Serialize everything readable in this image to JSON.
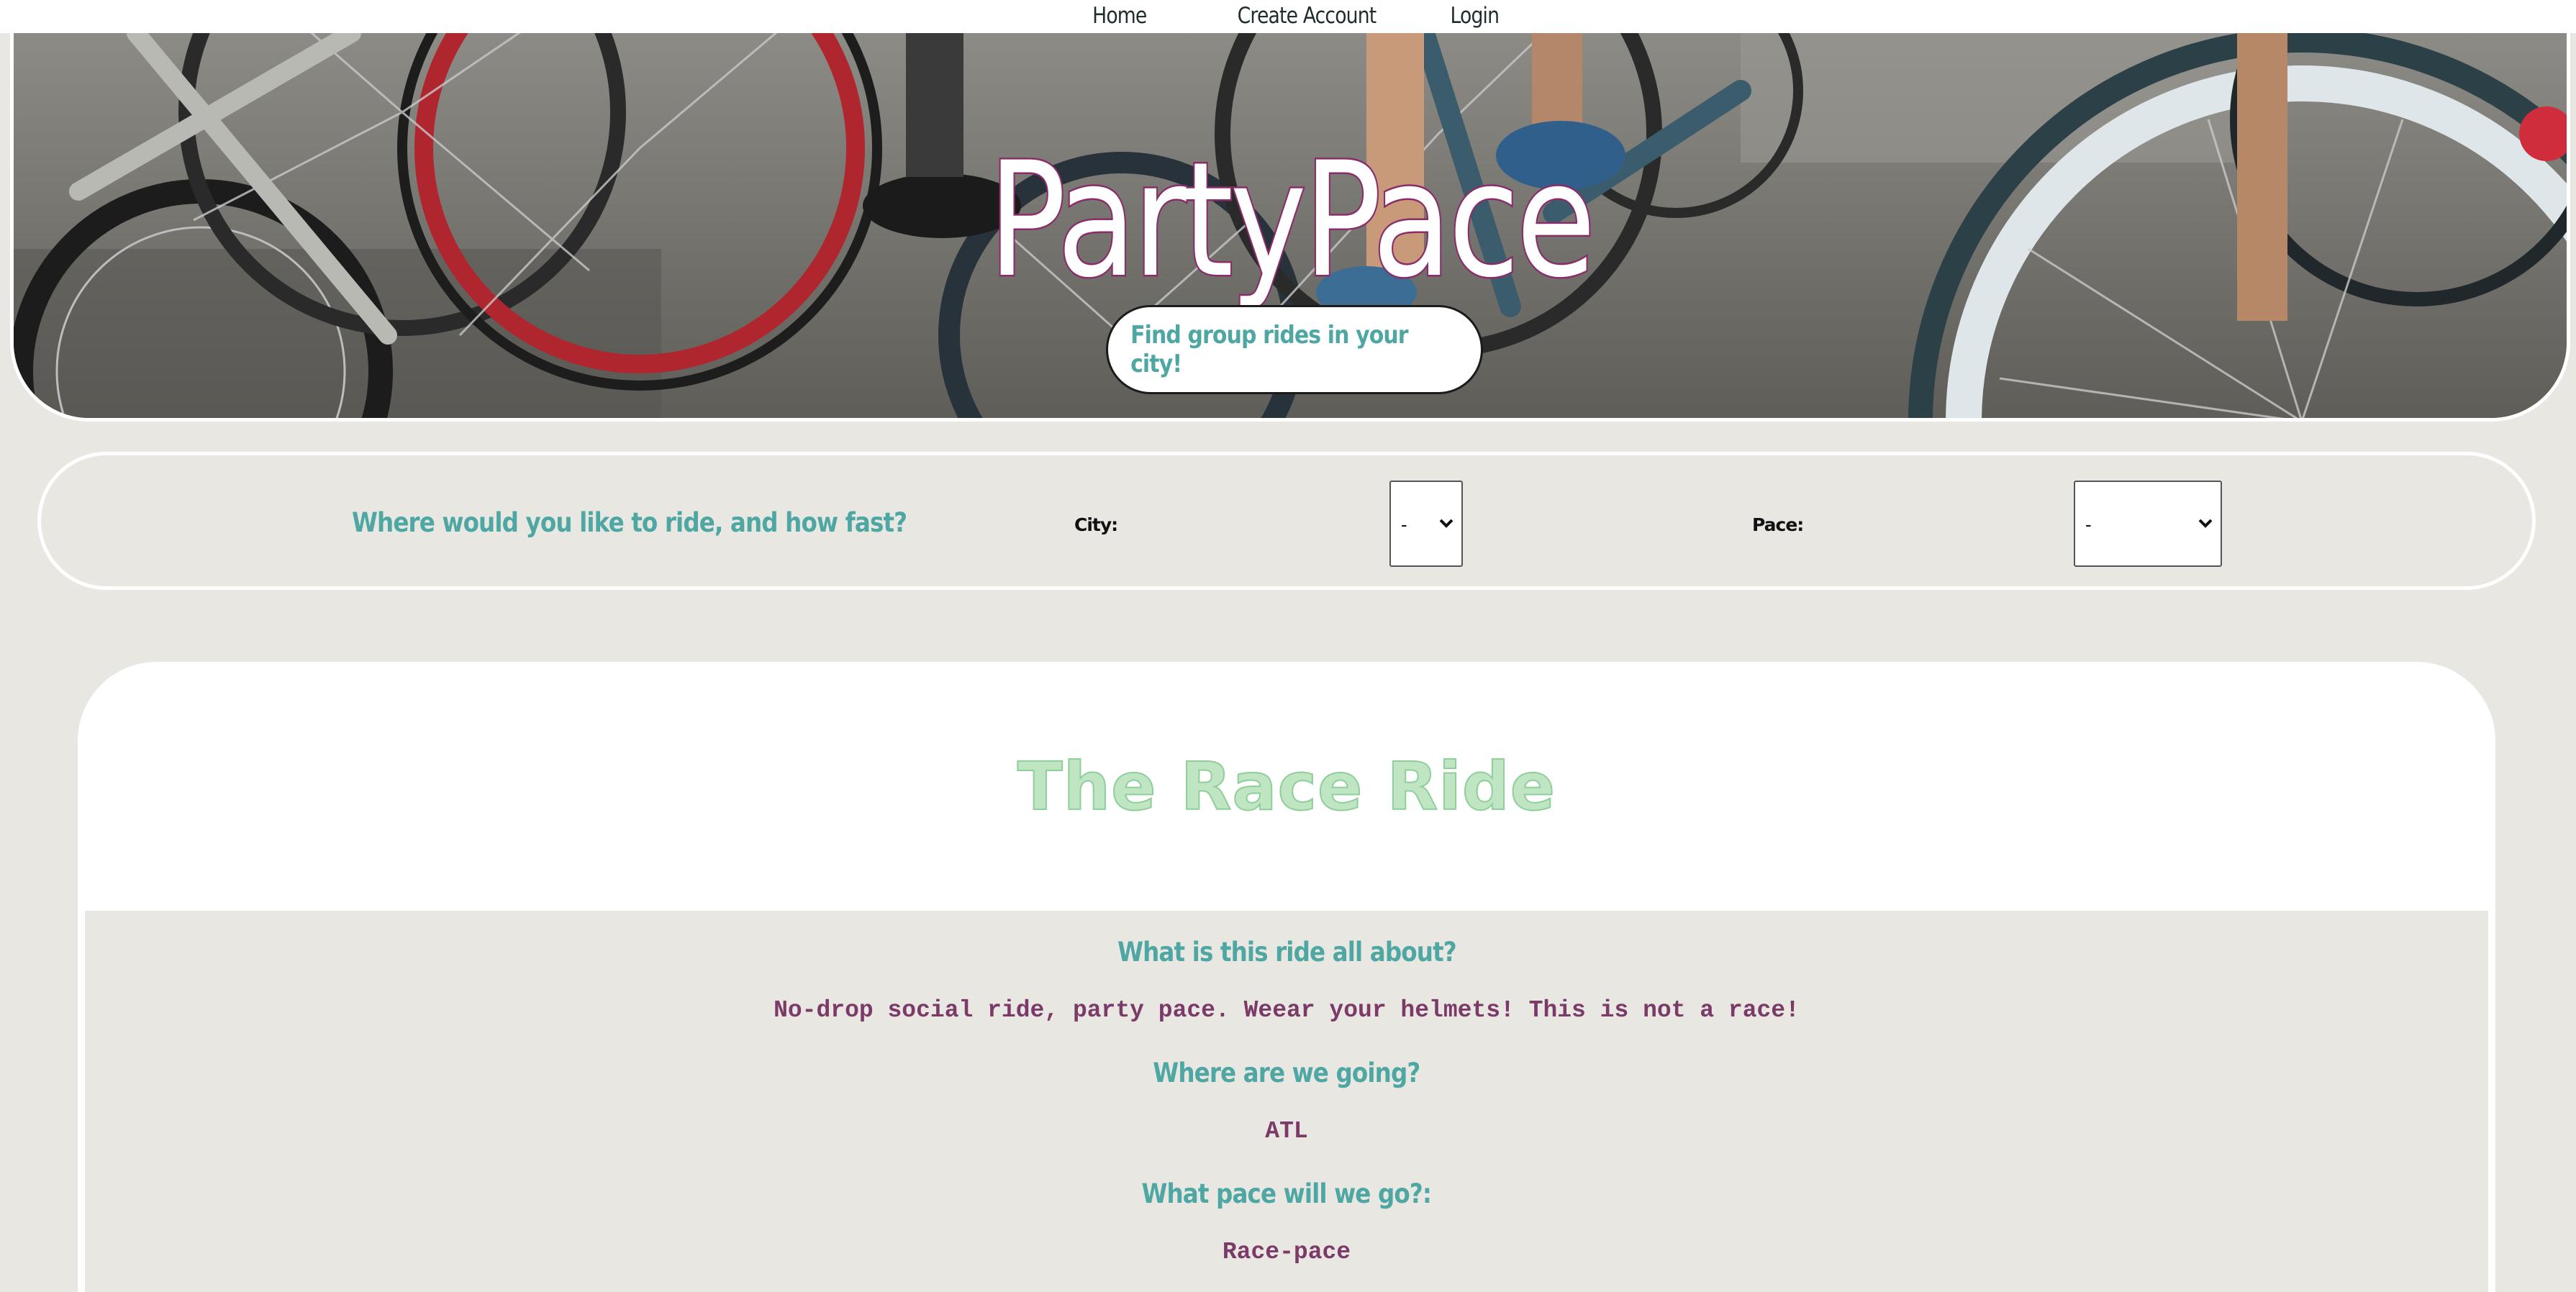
{
  "nav": {
    "home": "Home",
    "create_account": "Create Account",
    "login": "Login"
  },
  "hero": {
    "title": "PartyPace",
    "cta": "Find group rides in your city!",
    "background": "photo of bicycles and riders' legs on pavement"
  },
  "filter": {
    "question": "Where would you like to ride, and how fast?",
    "city_label": "City:",
    "city_value": "-",
    "pace_label": "Pace:",
    "pace_value": "-"
  },
  "ride": {
    "title": "The Race Ride",
    "about_q": "What is this ride all about?",
    "about_a": "No-drop social ride, party pace. Weear your helmets! This is not a race!",
    "where_q": "Where are we going?",
    "where_a": "ATL",
    "pace_q": "What pace will we go?:",
    "pace_a": "Race-pace"
  },
  "colors": {
    "accent_teal": "#4ea7a3",
    "answer_plum": "#7b3a68",
    "title_green": "#bfe5c3",
    "page_bg": "#e9e7e2"
  }
}
